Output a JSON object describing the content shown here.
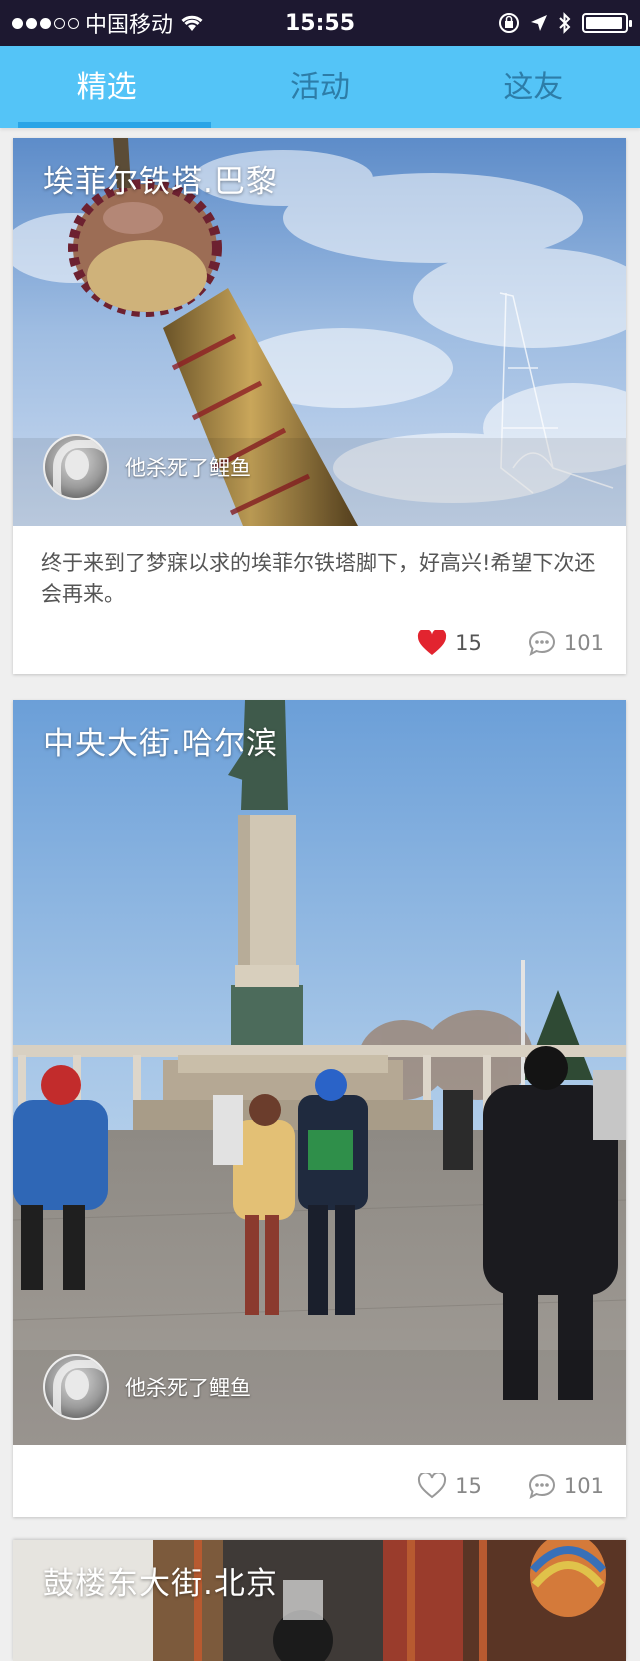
{
  "status_bar": {
    "carrier": "中国移动",
    "time": "15:55",
    "battery_level": 0.95
  },
  "tabs": [
    {
      "label": "精选",
      "active": true
    },
    {
      "label": "活动",
      "active": false
    },
    {
      "label": "这友",
      "active": false
    }
  ],
  "colors": {
    "tab_bar": "#54c4f7",
    "tab_active_text": "#ffffff",
    "tab_inactive_text": "#2d7da8",
    "like_active": "#e2242f"
  },
  "cards": [
    {
      "title": "埃菲尔铁塔.巴黎",
      "author": "他杀死了鲤鱼",
      "text": "终于来到了梦寐以求的埃菲尔铁塔脚下，好高兴!希望下次还会再来。",
      "likes": "15",
      "comments": "101",
      "liked": true
    },
    {
      "title": "中央大街.哈尔滨",
      "author": "他杀死了鲤鱼",
      "text": "",
      "likes": "15",
      "comments": "101",
      "liked": false
    },
    {
      "title": "鼓楼东大街.北京"
    }
  ]
}
